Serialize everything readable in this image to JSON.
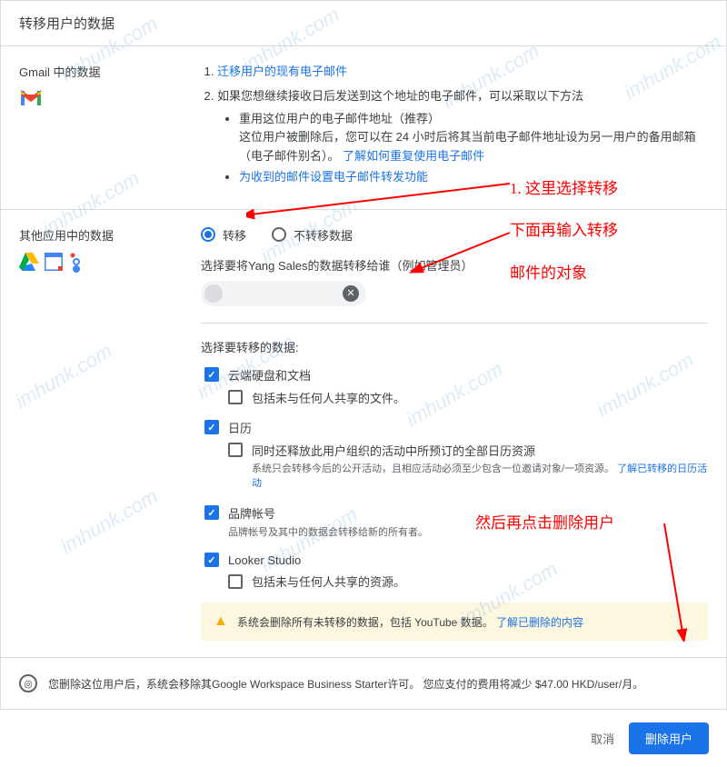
{
  "header": {
    "title": "转移用户的数据"
  },
  "gmail": {
    "title": "Gmail 中的数据",
    "item1": "迁移用户的现有电子邮件",
    "item2_prefix": "如果您想继续接收日后发送到这个地址的电子邮件，可以采取以下方法",
    "bullet1": "重用这位用户的电子邮件地址（推荐）",
    "bullet1_desc": "这位用户被删除后，您可以在 24 小时后将其当前电子邮件地址设为另一用户的备用邮箱（电子邮件别名）。",
    "bullet1_link": "了解如何重复使用电子邮件",
    "bullet2": "为收到的邮件设置电子邮件转发功能"
  },
  "apps": {
    "title": "其他应用中的数据",
    "radio_transfer": "转移",
    "radio_no_transfer": "不转移数据",
    "transfer_to_label": "选择要将Yang Sales的数据转移给谁（例如管理员）",
    "chip_text": "",
    "select_data_title": "选择要转移的数据:",
    "drive": {
      "label": "云端硬盘和文档",
      "sub": "包括未与任何人共享的文件。"
    },
    "calendar": {
      "label": "日历",
      "sub": "同时还释放此用户组织的活动中所预订的全部日历资源",
      "hint_prefix": "系统只会转移今后的公开活动，且相应活动必须至少包含一位邀请对象/一项资源。",
      "hint_link": "了解已转移的日历活动"
    },
    "brand": {
      "label": "品牌帐号",
      "hint": "品牌帐号及其中的数据会转移给新的所有者。"
    },
    "looker": {
      "label": "Looker Studio",
      "sub": "包括未与任何人共享的资源。"
    },
    "warning_text": "系统会删除所有未转移的数据，包括 YouTube 数据。",
    "warning_link": "了解已删除的内容"
  },
  "footer": {
    "text": "您删除这位用户后，系统会移除其Google Workspace Business Starter许可。 您应支付的费用将减少 $47.00 HKD/user/月。"
  },
  "actions": {
    "cancel": "取消",
    "delete": "删除用户"
  },
  "annotations": {
    "a1": "1. 这里选择转移",
    "a2": "下面再输入转移",
    "a3": "邮件的对象",
    "a4": "然后再点击删除用户"
  },
  "watermark": "imhunk.com"
}
